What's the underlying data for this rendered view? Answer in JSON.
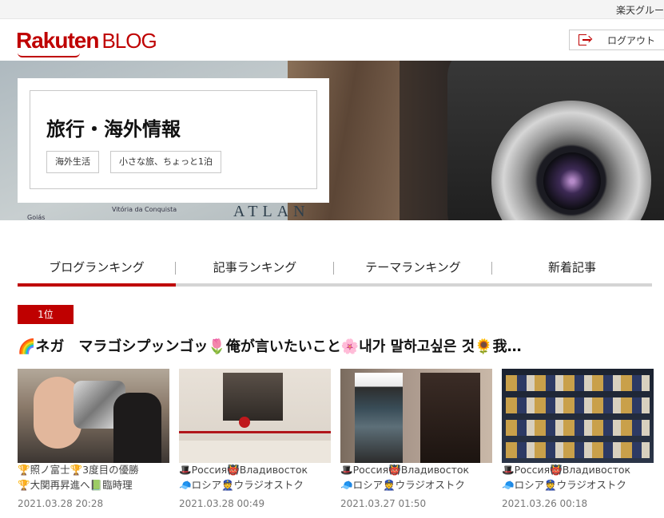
{
  "topbar": {
    "group_label": "楽天グルー"
  },
  "header": {
    "logo_main": "Rakuten",
    "logo_sub": "BLOG",
    "logout_label": "ログアウト"
  },
  "hero": {
    "title": "旅行・海外情報",
    "tags": [
      "海外生活",
      "小さな旅、ちょっと1泊"
    ],
    "map_text": "ATLAN",
    "map_small": [
      "Goiás",
      "Vitória da Conquista"
    ]
  },
  "tabs": [
    {
      "label": "ブログランキング",
      "active": true
    },
    {
      "label": "記事ランキング",
      "active": false
    },
    {
      "label": "テーマランキング",
      "active": false
    },
    {
      "label": "新着記事",
      "active": false
    }
  ],
  "ranking": {
    "badge": "1位",
    "title": "🌈ネガ　マラゴシプッンゴッ🌷俺が言いたいこと🌸내가 말하고싶은 것🌻我…"
  },
  "cards": [
    {
      "line1": "🏆照ノ富士🏆3度目の優勝",
      "line2": "🏆大関再昇進へ📗臨時理",
      "date": "2021.03.28 20:28"
    },
    {
      "line1": "🎩Россия👹Владивосток",
      "line2": "🧢ロシア👮ウラジオストク",
      "date": "2021.03.28 00:49"
    },
    {
      "line1": "🎩Россия👹Владивосток",
      "line2": "🧢ロシア👮ウラジオストク",
      "date": "2021.03.27 01:50"
    },
    {
      "line1": "🎩Россия👹Владивосток",
      "line2": "🧢ロシア👮ウラジオストク",
      "date": "2021.03.26 00:18"
    }
  ],
  "colors": {
    "brand_red": "#bf0000",
    "tab_inactive_line": "#d4d4d4"
  }
}
